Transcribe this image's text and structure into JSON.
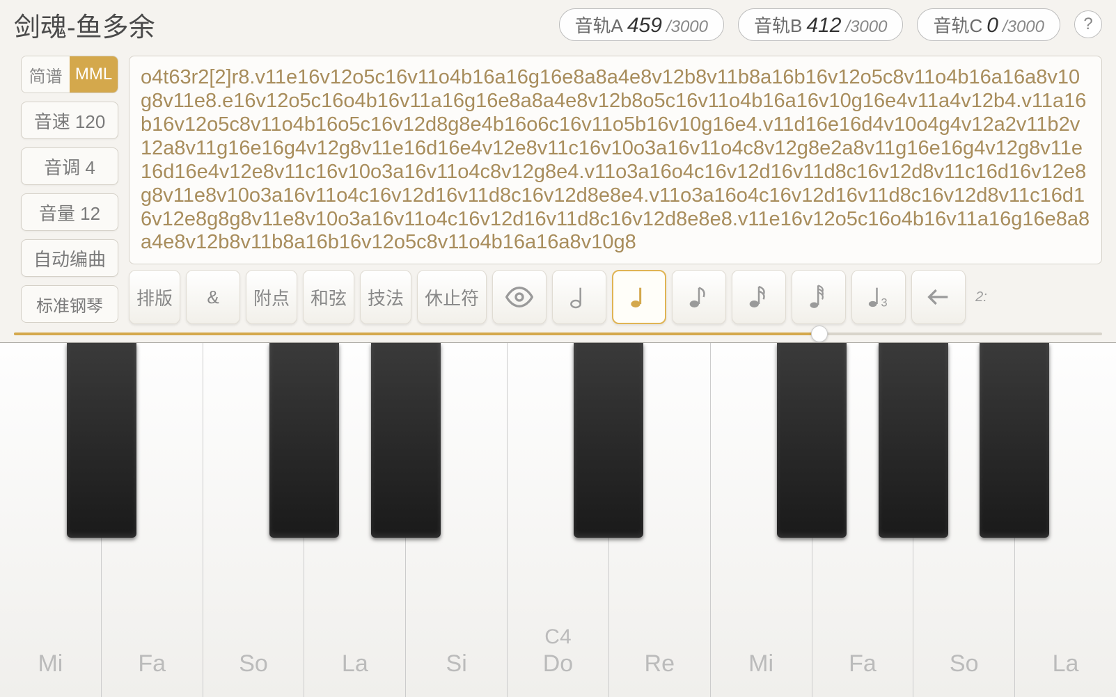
{
  "title": "剑魂-鱼多余",
  "tracks": [
    {
      "label": "音轨A",
      "current": "459",
      "max": "/3000"
    },
    {
      "label": "音轨B",
      "current": "412",
      "max": "/3000"
    },
    {
      "label": "音轨C",
      "current": "0",
      "max": "/3000"
    }
  ],
  "help": "?",
  "notation": {
    "opt1": "简谱",
    "opt2": "MML"
  },
  "sidebar": {
    "tempo": "音速 120",
    "pitch": "音调 4",
    "volume": "音量 12",
    "auto": "自动编曲",
    "instrument": "标准钢琴"
  },
  "mml": "o4t63r2[2]r8.v11e16v12o5c16v11o4b16a16g16e8a8a4e8v12b8v11b8a16b16v12o5c8v11o4b16a16a8v10g8v11e8.e16v12o5c16o4b16v11a16g16e8a8a4e8v12b8o5c16v11o4b16a16v10g16e4v11a4v12b4.v11a16b16v12o5c8v11o4b16o5c16v12d8g8e4b16o6c16v11o5b16v10g16e4.v11d16e16d4v10o4g4v12a2v11b2v12a8v11g16e16g4v12g8v11e16d16e4v12e8v11c16v10o3a16v11o4c8v12g8e2a8v11g16e16g4v12g8v11e16d16e4v12e8v11c16v10o3a16v11o4c8v12g8e4.v11o3a16o4c16v12d16v11d8c16v12d8v11c16d16v12e8g8v11e8v10o3a16v11o4c16v12d16v11d8c16v12d8e8e4.v11o3a16o4c16v12d16v11d8c16v12d8v11c16d16v12e8g8g8v11e8v10o3a16v11o4c16v12d16v11d8c16v12d8e8e8.v11e16v12o5c16o4b16v11a16g16e8a8a4e8v12b8v11b8a16b16v12o5c8v11o4b16a16a8v10g8",
  "tools": {
    "layout": "排版",
    "amp": "&",
    "dot": "附点",
    "chord": "和弦",
    "tech": "技法",
    "rest": "休止符"
  },
  "time": "2:",
  "slider": {
    "pct": 74
  },
  "keys": {
    "white": [
      {
        "label": "Mi",
        "note": ""
      },
      {
        "label": "Fa",
        "note": ""
      },
      {
        "label": "So",
        "note": ""
      },
      {
        "label": "La",
        "note": ""
      },
      {
        "label": "Si",
        "note": ""
      },
      {
        "label": "Do",
        "note": "C4"
      },
      {
        "label": "Re",
        "note": ""
      },
      {
        "label": "Mi",
        "note": ""
      },
      {
        "label": "Fa",
        "note": ""
      },
      {
        "label": "So",
        "note": ""
      },
      {
        "label": "La",
        "note": ""
      }
    ],
    "black_positions": [
      1,
      3,
      4,
      6,
      8,
      9,
      10
    ]
  }
}
